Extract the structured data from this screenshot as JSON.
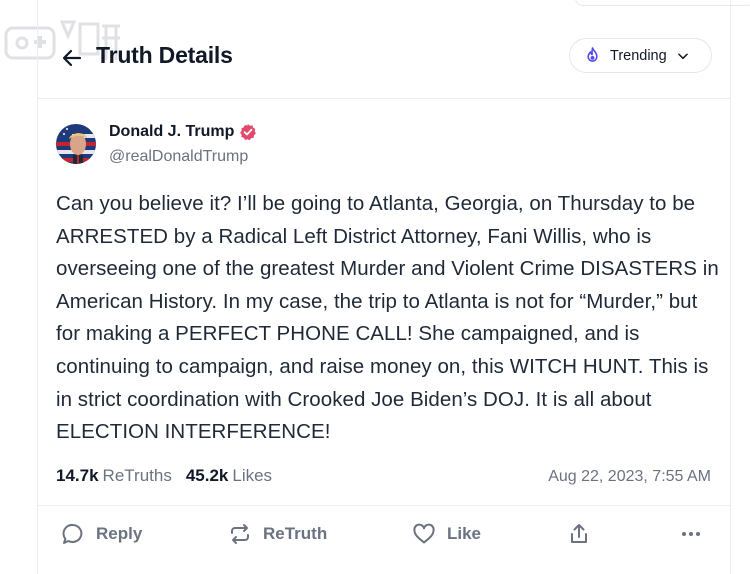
{
  "header": {
    "title": "Truth Details",
    "trending_label": "Trending"
  },
  "post": {
    "author_name": "Donald J. Trump",
    "author_handle": "@realDonaldTrump",
    "verified": true,
    "text": "Can you believe it? I’ll be going to Atlanta, Georgia, on Thursday to be ARRESTED by a Radical Left District Attorney, Fani Willis, who is overseeing one of the greatest Murder and Violent Crime DISASTERS in American History. In my case, the trip to Atlanta is not for “Murder,” but for making a PERFECT PHONE CALL! She campaigned, and is continuing to campaign, and raise money on, this WITCH HUNT. This is in strict coordination with Crooked Joe Biden’s DOJ. It is all about ELECTION INTERFERENCE!",
    "retruths_count": "14.7k",
    "retruths_label": "ReTruths",
    "likes_count": "45.2k",
    "likes_label": "Likes",
    "timestamp": "Aug 22, 2023, 7:55 AM"
  },
  "actions": {
    "reply_label": "Reply",
    "retruth_label": "ReTruth",
    "like_label": "Like"
  },
  "icons": {
    "back": "arrow-left-icon",
    "trending": "flame-icon",
    "dropdown": "chevron-down-icon",
    "verified": "verified-badge-icon",
    "reply": "speech-bubble-icon",
    "retruth": "repost-arrows-icon",
    "like": "heart-icon",
    "share": "share-upload-icon",
    "more": "more-dots-icon"
  },
  "colors": {
    "accent": "#5448ee",
    "verified": "#e2496a",
    "text": "#1f2937",
    "muted": "#6b7280"
  }
}
